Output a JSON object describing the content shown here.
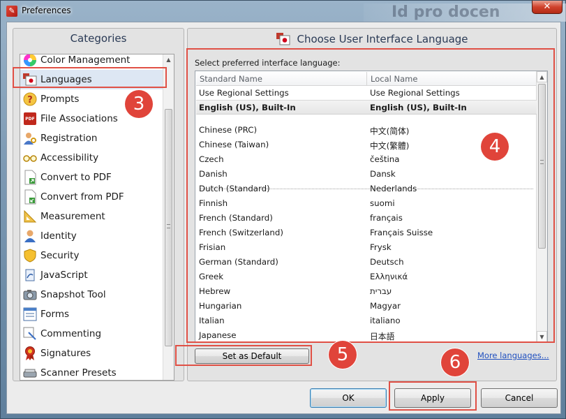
{
  "window": {
    "title": "Preferences",
    "close_glyph": "✕",
    "background_doc_text": "Id pro docen"
  },
  "categories": {
    "header": "Categories",
    "items": [
      {
        "label": "Color Management",
        "icon": "color-wheel-icon"
      },
      {
        "label": "Languages",
        "icon": "flag-icon",
        "selected": true
      },
      {
        "label": "Prompts",
        "icon": "question-icon"
      },
      {
        "label": "File Associations",
        "icon": "pdf-file-icon"
      },
      {
        "label": "Registration",
        "icon": "user-key-icon"
      },
      {
        "label": "Accessibility",
        "icon": "glasses-icon"
      },
      {
        "label": "Convert to PDF",
        "icon": "convert-to-pdf-icon"
      },
      {
        "label": "Convert from PDF",
        "icon": "convert-from-pdf-icon"
      },
      {
        "label": "Measurement",
        "icon": "ruler-icon"
      },
      {
        "label": "Identity",
        "icon": "identity-icon"
      },
      {
        "label": "Security",
        "icon": "shield-icon"
      },
      {
        "label": "JavaScript",
        "icon": "javascript-icon"
      },
      {
        "label": "Snapshot Tool",
        "icon": "camera-icon"
      },
      {
        "label": "Forms",
        "icon": "forms-icon"
      },
      {
        "label": "Commenting",
        "icon": "comment-icon"
      },
      {
        "label": "Signatures",
        "icon": "signature-ribbon-icon"
      },
      {
        "label": "Scanner Presets",
        "icon": "scanner-icon"
      }
    ]
  },
  "language_panel": {
    "header": "Choose User Interface Language",
    "sub_label": "Select preferred interface language:",
    "columns": [
      "Standard Name",
      "Local Name"
    ],
    "pinned_rows": [
      {
        "standard": "Use Regional Settings",
        "local": "Use Regional Settings"
      },
      {
        "standard": "English (US), Built-In",
        "local": "English (US), Built-In"
      }
    ],
    "rows": [
      {
        "standard": "Chinese (PRC)",
        "local": "中文(简体)"
      },
      {
        "standard": "Chinese (Taiwan)",
        "local": "中文(繁體)"
      },
      {
        "standard": "Czech",
        "local": "čeština"
      },
      {
        "standard": "Danish",
        "local": "Dansk"
      },
      {
        "standard": "Dutch (Standard)",
        "local": "Nederlands"
      },
      {
        "standard": "Finnish",
        "local": "suomi"
      },
      {
        "standard": "French (Standard)",
        "local": "français"
      },
      {
        "standard": "French (Switzerland)",
        "local": "Français Suisse"
      },
      {
        "standard": "Frisian",
        "local": "Frysk"
      },
      {
        "standard": "German (Standard)",
        "local": "Deutsch"
      },
      {
        "standard": "Greek",
        "local": "Ελληνικά"
      },
      {
        "standard": "Hebrew",
        "local": "עברית"
      },
      {
        "standard": "Hungarian",
        "local": "Magyar"
      },
      {
        "standard": "Italian",
        "local": "italiano"
      },
      {
        "standard": "Japanese",
        "local": "日本語"
      }
    ],
    "set_default_label": "Set as Default",
    "more_languages_label": "More languages..."
  },
  "footer": {
    "ok_label": "OK",
    "apply_label": "Apply",
    "cancel_label": "Cancel"
  },
  "annotations": [
    "3",
    "4",
    "5",
    "6"
  ],
  "colors": {
    "annotation_red": "#e0443a",
    "link_blue": "#1f4fbf",
    "selection_bg": "#dde7f3"
  }
}
